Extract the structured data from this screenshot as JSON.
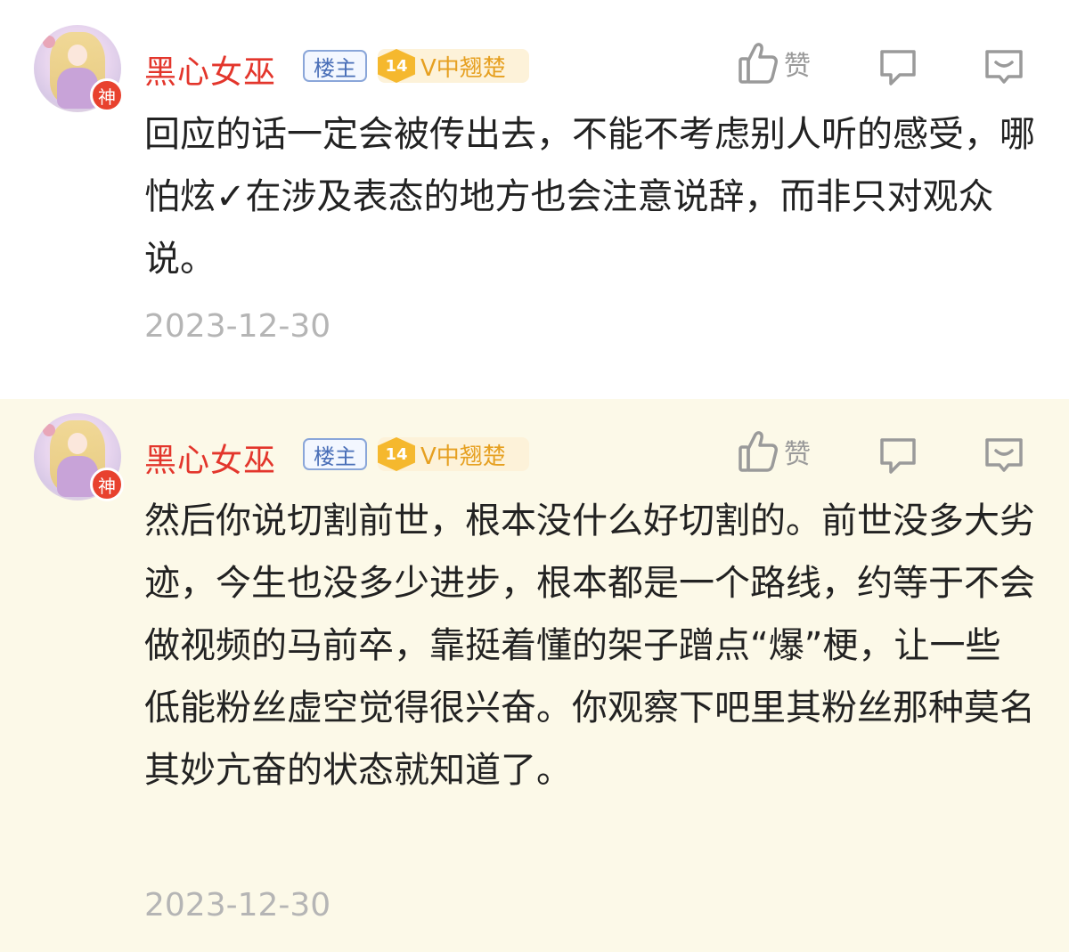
{
  "comments": [
    {
      "username": "黑心女巫",
      "owner_badge": "楼主",
      "level": "14",
      "level_title": "V中翘楚",
      "god_badge": "神",
      "like_label": "赞",
      "text": "回应的话一定会被传出去，不能不考虑别人听的感受，哪怕炫✓在涉及表态的地方也会注意说辞，而非只对观众说。",
      "date": "2023-12-30"
    },
    {
      "username": "黑心女巫",
      "owner_badge": "楼主",
      "level": "14",
      "level_title": "V中翘楚",
      "god_badge": "神",
      "like_label": "赞",
      "text": "然后你说切割前世，根本没什么好切割的。前世没多大劣迹，今生也没多少进步，根本都是一个路线，约等于不会做视频的马前卒，靠挺着懂的架子蹭点“爆”梗，让一些低能粉丝虚空觉得很兴奋。你观察下吧里其粉丝那种莫名其妙亢奋的状态就知道了。",
      "date": "2023-12-30"
    }
  ],
  "icons": {
    "like": "thumbs-up-icon",
    "reply": "speech-bubble-icon",
    "more": "more-bubble-icon"
  },
  "colors": {
    "username": "#e3362c",
    "owner_badge": "#4a6fb8",
    "level_badge": "#f5b82e",
    "highlight_bg": "#fcf9e8",
    "date": "#b5b5b5"
  }
}
